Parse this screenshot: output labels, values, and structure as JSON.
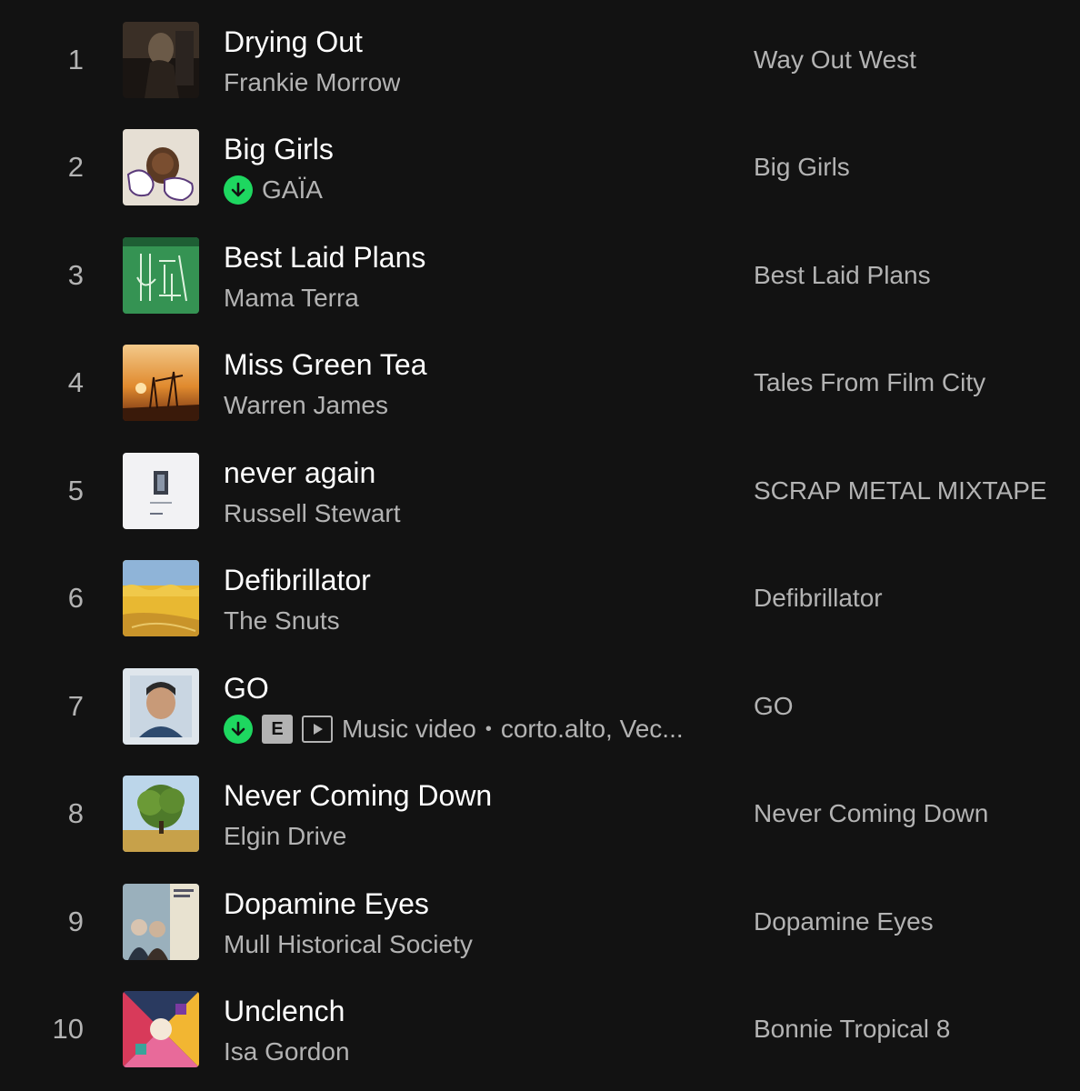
{
  "tracks": [
    {
      "number": "1",
      "title": "Drying Out",
      "artist": "Frankie Morrow",
      "album": "Way Out West",
      "cover_icon": "album-cover-dark"
    },
    {
      "number": "2",
      "title": "Big Girls",
      "artist": "GAÏA",
      "album": "Big Girls",
      "downloaded": true,
      "cover_icon": "album-cover-big-girls"
    },
    {
      "number": "3",
      "title": "Best Laid Plans",
      "artist": "Mama Terra",
      "album": "Best Laid Plans",
      "cover_icon": "album-cover-green"
    },
    {
      "number": "4",
      "title": "Miss Green Tea",
      "artist": "Warren James",
      "album": "Tales From Film City",
      "cover_icon": "album-cover-sunset"
    },
    {
      "number": "5",
      "title": "never again",
      "artist": "Russell Stewart",
      "album": "SCRAP METAL MIXTAPE",
      "cover_icon": "album-cover-white"
    },
    {
      "number": "6",
      "title": "Defibrillator",
      "artist": "The Snuts",
      "album": "Defibrillator",
      "cover_icon": "album-cover-yellow"
    },
    {
      "number": "7",
      "title": "GO",
      "downloaded": true,
      "explicit": true,
      "explicit_label": "E",
      "music_video": true,
      "type_label": "Music video",
      "separator": "•",
      "artist": "corto.alto, Vec...",
      "album": "GO",
      "cover_icon": "album-cover-portrait"
    },
    {
      "number": "8",
      "title": "Never Coming Down",
      "artist": "Elgin Drive",
      "album": "Never Coming Down",
      "cover_icon": "album-cover-tree"
    },
    {
      "number": "9",
      "title": "Dopamine Eyes",
      "artist": "Mull Historical Society",
      "album": "Dopamine Eyes",
      "cover_icon": "album-cover-photo"
    },
    {
      "number": "10",
      "title": "Unclench",
      "artist": "Isa Gordon",
      "album": "Bonnie Tropical 8",
      "cover_icon": "album-cover-pattern"
    }
  ],
  "colors": {
    "background": "#121212",
    "primary_text": "#ffffff",
    "secondary_text": "#b3b3b3",
    "download_green": "#1ed760"
  },
  "icons": {
    "download": "download-arrow-icon",
    "explicit": "explicit-badge",
    "video": "music-video-icon"
  }
}
